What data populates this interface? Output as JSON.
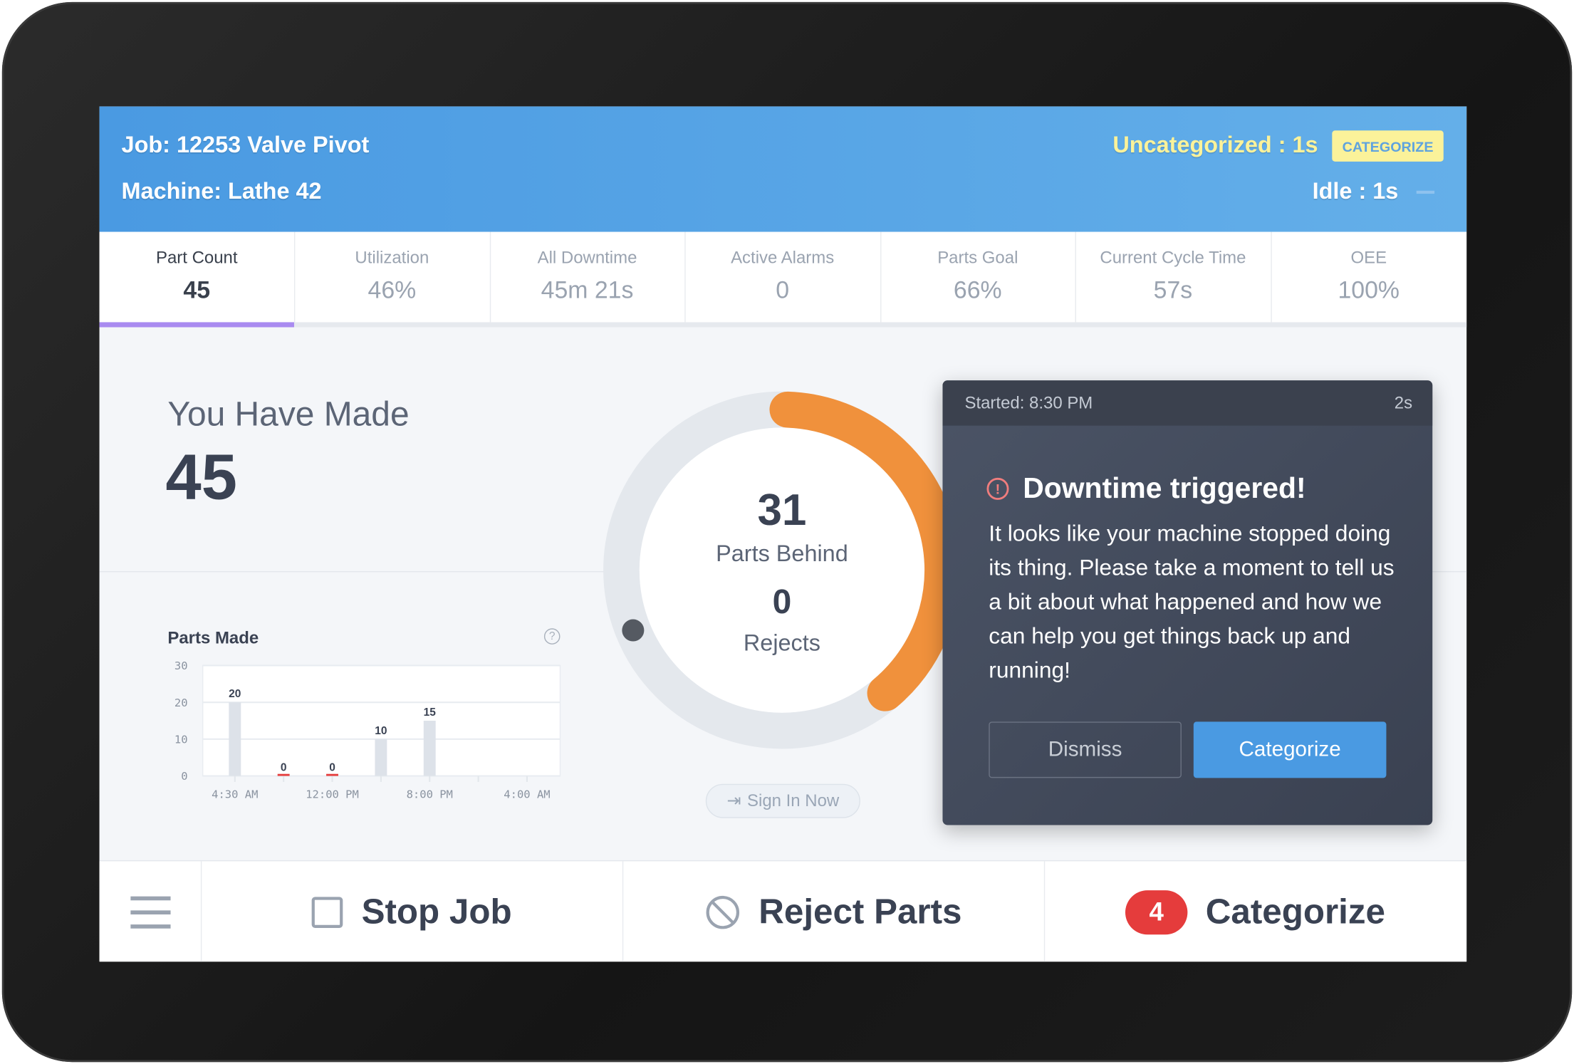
{
  "header": {
    "job": "Job: 12253 Valve Pivot",
    "machine": "Machine: Lathe 42",
    "uncategorized": "Uncategorized : 1s",
    "categorize_button": "CATEGORIZE",
    "idle": "Idle : 1s"
  },
  "tabs": [
    {
      "label": "Part Count",
      "value": "45",
      "active": true
    },
    {
      "label": "Utilization",
      "value": "46%"
    },
    {
      "label": "All Downtime",
      "value": "45m 21s"
    },
    {
      "label": "Active Alarms",
      "value": "0"
    },
    {
      "label": "Parts Goal",
      "value": "66%"
    },
    {
      "label": "Current Cycle Time",
      "value": "57s"
    },
    {
      "label": "OEE",
      "value": "100%"
    }
  ],
  "made": {
    "title": "You Have Made",
    "value": "45"
  },
  "progress": {
    "behind_value": "31",
    "behind_label": "Parts Behind",
    "rejects_value": "0",
    "rejects_label": "Rejects",
    "arc_color": "#f0913c"
  },
  "sign_in": {
    "label": "Sign In Now",
    "icon": "sign-in-icon"
  },
  "chart_data": {
    "type": "bar",
    "title": "Parts Made",
    "ylim": [
      0,
      30
    ],
    "yticks": [
      "0",
      "10",
      "20",
      "30"
    ],
    "xtick_labels": [
      "4:30 AM",
      "12:00 PM",
      "8:00 PM",
      "4:00 AM"
    ],
    "categories": [
      "4:30 AM",
      "",
      "12:00 PM",
      "",
      "8:00 PM"
    ],
    "values": [
      20,
      0,
      0,
      10,
      15
    ],
    "grid": true,
    "bar_color": "#dde2e9",
    "zero_color": "#e53c3c"
  },
  "popup": {
    "started": "Started: 8:30 PM",
    "elapsed": "2s",
    "title": "Downtime triggered!",
    "body": "It looks like your machine stopped doing its thing. Please take a moment to tell us a bit about what happened and how we can help you get things back up and running!",
    "dismiss": "Dismiss",
    "categorize": "Categorize"
  },
  "bottom": {
    "stop_job": "Stop Job",
    "reject_parts": "Reject Parts",
    "categorize": "Categorize",
    "categorize_count": "4"
  },
  "colors": {
    "header": "#4a9ae2",
    "accent_yellow": "#fbf29a",
    "active_tab": "#a98bf0",
    "primary": "#4a9ae2"
  }
}
